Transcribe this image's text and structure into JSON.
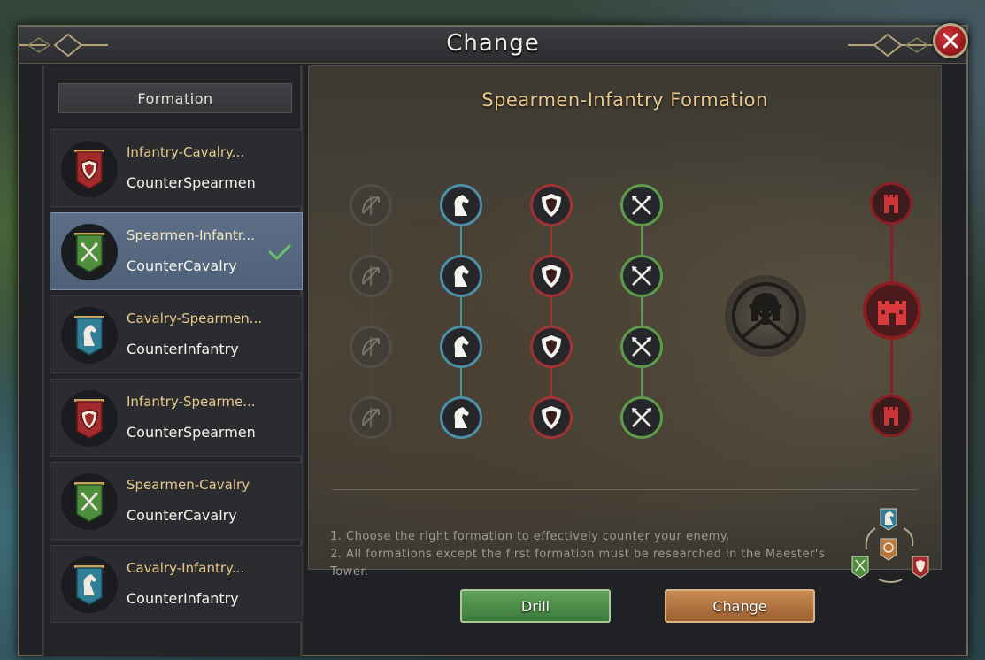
{
  "window": {
    "title": "Change"
  },
  "sidebar": {
    "header": "Formation",
    "items": [
      {
        "name": "Infantry-Cavalry...",
        "counter": "CounterSpearmen",
        "banner": "red",
        "icon": "shield-icon",
        "selected": false
      },
      {
        "name": "Spearmen-Infantr...",
        "counter": "CounterCavalry",
        "banner": "green",
        "icon": "crossed-spears-icon",
        "selected": true
      },
      {
        "name": "Cavalry-Spearmen...",
        "counter": "CounterInfantry",
        "banner": "teal",
        "icon": "horse-icon",
        "selected": false
      },
      {
        "name": "Infantry-Spearme...",
        "counter": "CounterSpearmen",
        "banner": "red",
        "icon": "shield-icon",
        "selected": false
      },
      {
        "name": "Spearmen-Cavalry",
        "counter": "CounterCavalry",
        "banner": "green",
        "icon": "crossed-spears-icon",
        "selected": false
      },
      {
        "name": "Cavalry-Infantry...",
        "counter": "CounterInfantry",
        "banner": "teal",
        "icon": "horse-icon",
        "selected": false
      }
    ]
  },
  "main": {
    "title": "Spearmen-Infantry Formation",
    "tips": [
      "1. Choose the right formation to effectively counter your enemy.",
      "2. All formations except the first formation must be researched in the Maester's Tower."
    ]
  },
  "buttons": {
    "drill": "Drill",
    "change": "Change"
  },
  "colors": {
    "infantry": "#a03232",
    "cavalry": "#4f8ea7",
    "spearmen": "#5d9a4a",
    "archer": "#5a5652",
    "tower": "#8b1e22"
  }
}
